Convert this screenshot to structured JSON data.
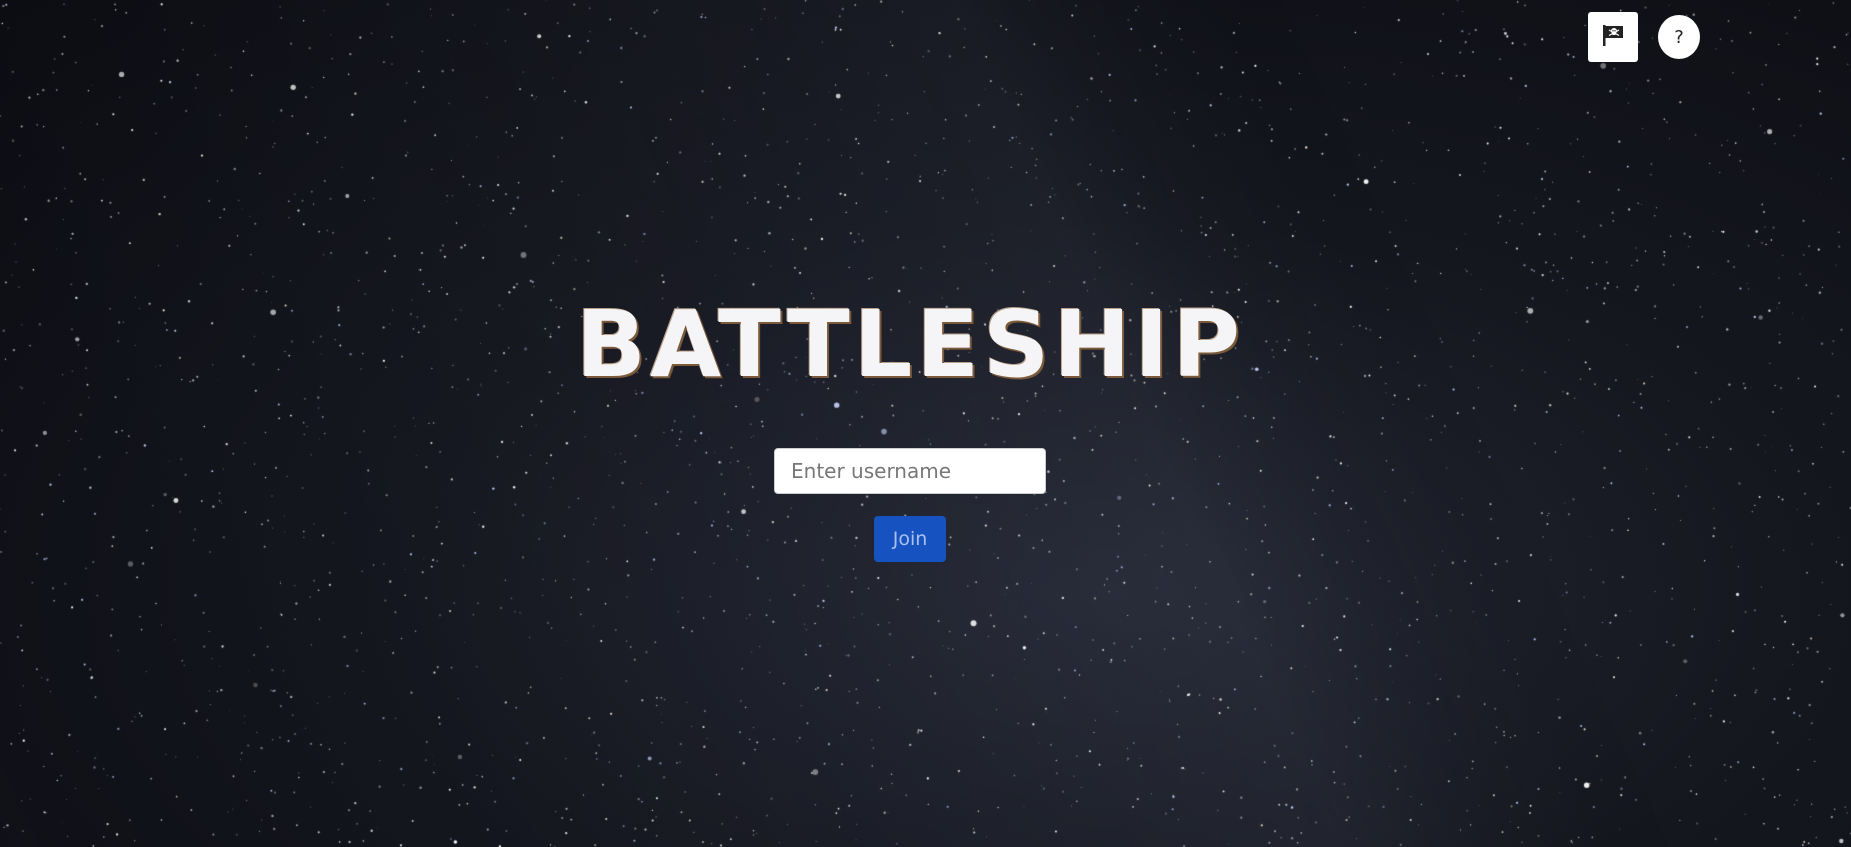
{
  "header": {
    "flag_icon": "pirate-flag-icon",
    "flag_glyph": "🏴‍☠️",
    "help_label": "?"
  },
  "main": {
    "title": "BATTLESHIP",
    "username_placeholder": "Enter username",
    "username_value": "",
    "join_label": "Join"
  },
  "colors": {
    "background": "#111318",
    "join_button": "#1753c0",
    "title": "#f5f5f7"
  }
}
